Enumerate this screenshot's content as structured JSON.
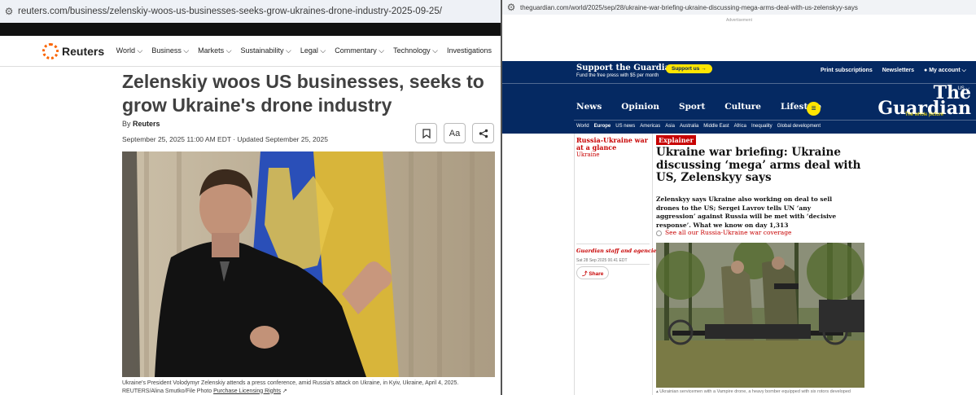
{
  "left": {
    "url": "reuters.com/business/zelenskiy-woos-us-businesses-seeks-grow-ukraines-drone-industry-2025-09-25/",
    "logo": "Reuters",
    "menu": [
      "World",
      "Business",
      "Markets",
      "Sustainability",
      "Legal",
      "Commentary",
      "Technology",
      "Investigations"
    ],
    "headline": "Zelenskiy woos US businesses, seeks to grow Ukraine's drone industry",
    "by_prefix": "By",
    "author": "Reuters",
    "date": "September 25, 2025 11:00 AM EDT · Updated September 25, 2025",
    "buttons": {
      "bookmark_icon": "bookmark-icon",
      "text_size_label": "Aa",
      "share_icon": "share-icon"
    },
    "caption": "Ukraine's President Volodymyr Zelenskiy attends a press conference, amid Russia's attack on Ukraine, in Kyiv, Ukraine, April 4, 2025.",
    "credit": "REUTERS/Alina Smutko/File Photo",
    "licensing": "Purchase Licensing Rights",
    "colors": {
      "accent": "#fa6400"
    }
  },
  "right": {
    "url": "theguardian.com/world/2025/sep/28/ukraine-war-briefing-ukraine-discussing-mega-arms-deal-with-us-zelenskyy-says",
    "advertisement": "Advertisement",
    "support_title": "Support the Guardian",
    "support_sub": "Fund the free press with $5 per month",
    "support_button": "Support us →",
    "top_links": [
      "Print subscriptions",
      "Newsletters",
      "My account"
    ],
    "pillars": [
      "News",
      "Opinion",
      "Sport",
      "Culture",
      "Lifestyle"
    ],
    "subnav": [
      "World",
      "Europe",
      "US news",
      "Americas",
      "Asia",
      "Australia",
      "Middle East",
      "Africa",
      "Inequality",
      "Global development"
    ],
    "edition": "US",
    "logo_line1": "The",
    "logo_line2": "Guardian",
    "tagline": "The whole picture",
    "section": "Russia-Ukraine war at a glance",
    "section_sub": "Ukraine",
    "label": "Explainer",
    "headline": "Ukraine war briefing: Ukraine discussing ‘mega’ arms deal with US, Zelenskyy says",
    "standfirst": "Zelenskyy says Ukraine also working on deal to sell drones to the US; Sergei Lavrov tells UN ‘any aggression’ against Russia will be met with ‘decisive response’. What we know on day 1,313",
    "see_all": "See all our Russia-Ukraine war coverage",
    "byline": "Guardian staff and agencies",
    "dateline": "Sat 28 Sep 2025 00.41 EDT",
    "share": "Share",
    "caption": "Ukrainian servicemen with a Vampire drone, a heavy bomber equipped with six rotors developed",
    "colors": {
      "brand": "#052962",
      "news": "#c70000",
      "highlight": "#ffe500"
    }
  }
}
